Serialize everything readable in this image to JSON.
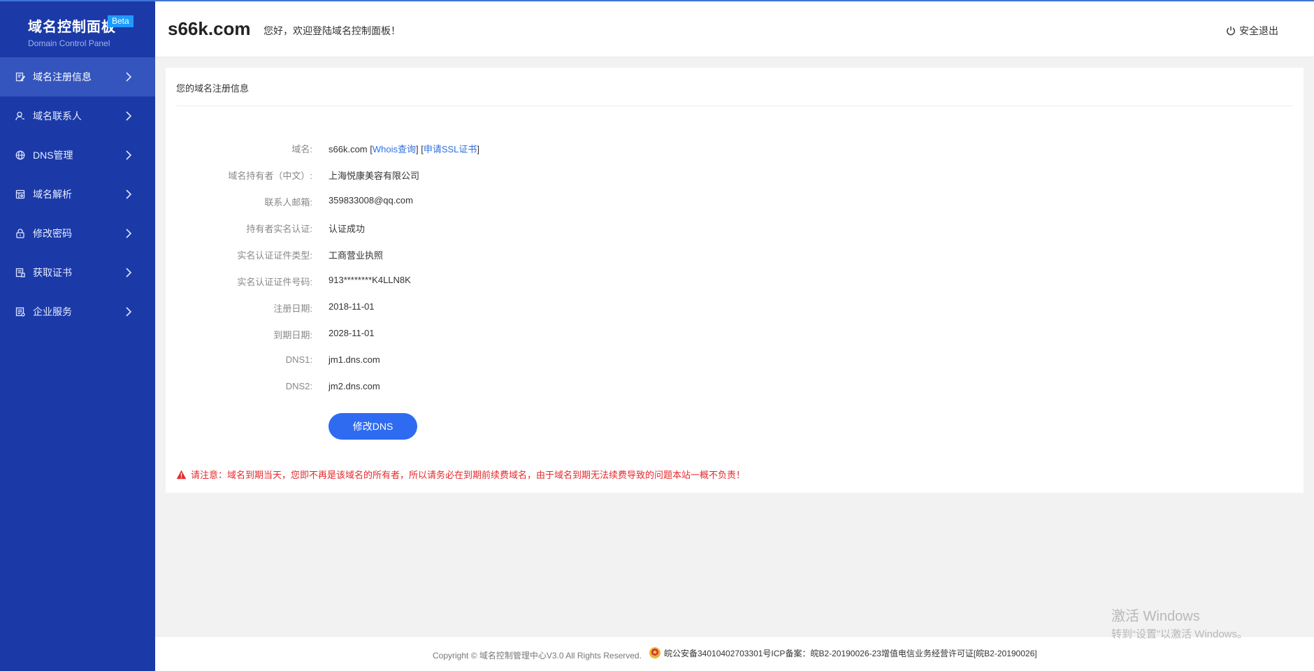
{
  "brand": {
    "title": "域名控制面板",
    "badge": "Beta",
    "subtitle": "Domain Control Panel"
  },
  "sidebar": {
    "items": [
      {
        "label": "域名注册信息",
        "icon": "edit-doc-icon"
      },
      {
        "label": "域名联系人",
        "icon": "user-icon"
      },
      {
        "label": "DNS管理",
        "icon": "globe-icon"
      },
      {
        "label": "域名解析",
        "icon": "resolve-icon"
      },
      {
        "label": "修改密码",
        "icon": "lock-icon"
      },
      {
        "label": "获取证书",
        "icon": "certificate-icon"
      },
      {
        "label": "企业服务",
        "icon": "service-icon"
      }
    ]
  },
  "header": {
    "domain": "s66k.com",
    "welcome": "您好，欢迎登陆域名控制面板！",
    "logout": "安全退出"
  },
  "card": {
    "title": "您的域名注册信息",
    "fields": [
      {
        "label": "域名:",
        "value": "s66k.com"
      },
      {
        "label": "域名持有者（中文）:",
        "value": "上海悦康美容有限公司"
      },
      {
        "label": "联系人邮箱:",
        "value": "359833008@qq.com"
      },
      {
        "label": "持有者实名认证:",
        "value": "认证成功"
      },
      {
        "label": "实名认证证件类型:",
        "value": "工商营业执照"
      },
      {
        "label": "实名认证证件号码:",
        "value": "913********K4LLN8K"
      },
      {
        "label": "注册日期:",
        "value": "2018-11-01"
      },
      {
        "label": "到期日期:",
        "value": "2028-11-01"
      },
      {
        "label": "DNS1:",
        "value": "jm1.dns.com"
      },
      {
        "label": "DNS2:",
        "value": "jm2.dns.com"
      }
    ],
    "whois_link": "Whois查询",
    "ssl_link": "申请SSL证书",
    "button": "修改DNS",
    "notice": "请注意：域名到期当天，您即不再是该域名的所有者，所以请务必在到期前续费域名，由于域名到期无法续费导致的问题本站一概不负责！"
  },
  "footer": {
    "copyright": "Copyright © 域名控制管理中心V3.0 All Rights Reserved.",
    "beian": "皖公安备34010402703301号ICP备案：皖B2-20190026-23增值电信业务经营许可证[皖B2-20190026]"
  },
  "watermark": {
    "line1": "激活 Windows",
    "line2": "转到“设置”以激活 Windows。"
  },
  "colors": {
    "sidebar_bg": "#1b3aa8",
    "sidebar_active": "#3455bd",
    "accent": "#2f6bf0",
    "link": "#2f6fe0",
    "warning": "#e6292c"
  }
}
